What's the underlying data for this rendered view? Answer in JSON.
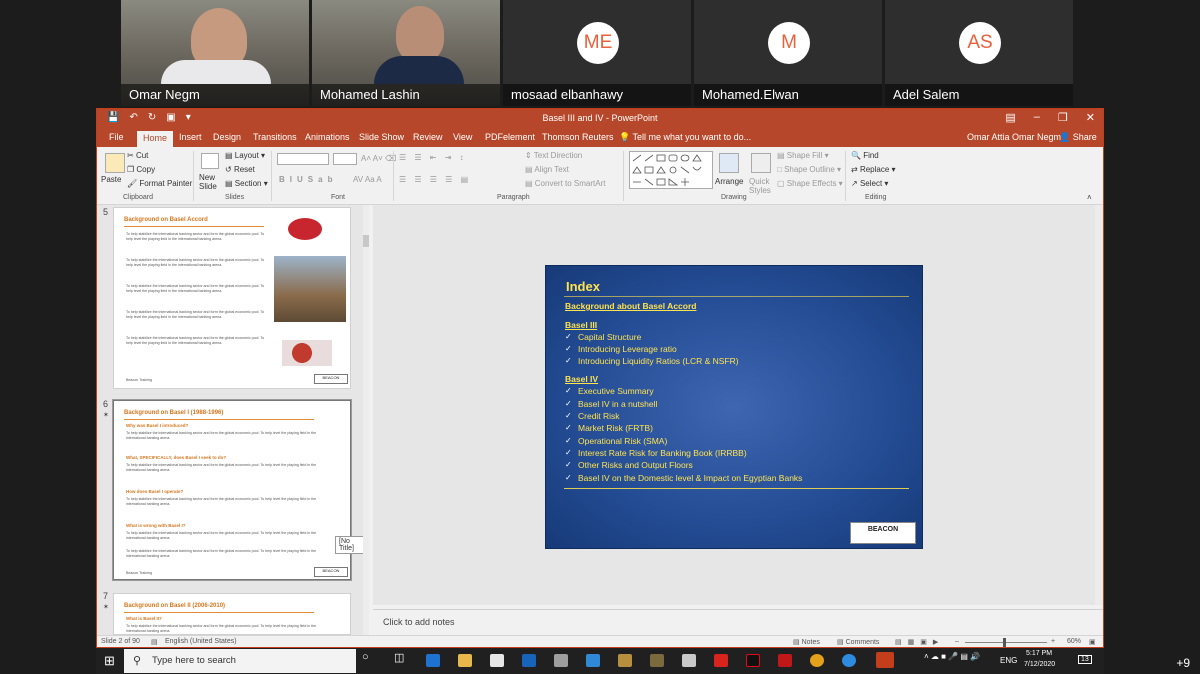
{
  "participants": [
    {
      "name": "Omar Negm",
      "type": "video"
    },
    {
      "name": "Mohamed Lashin",
      "type": "video"
    },
    {
      "name": "mosaad elbanhawy",
      "type": "avatar",
      "initials": "ME"
    },
    {
      "name": "Mohamed.Elwan",
      "type": "avatar",
      "initials": "M"
    },
    {
      "name": "Adel Salem",
      "type": "avatar",
      "initials": "AS"
    }
  ],
  "window": {
    "title": "Basel III and IV - PowerPoint",
    "user": "Omar Attia Omar Negm",
    "share": "Share"
  },
  "tabs": [
    "File",
    "Home",
    "Insert",
    "Design",
    "Transitions",
    "Animations",
    "Slide Show",
    "Review",
    "View",
    "PDFelement",
    "Thomson Reuters"
  ],
  "tell_me": "Tell me what you want to do...",
  "ribbon": {
    "paste": "Paste",
    "cut": "Cut",
    "copy": "Copy",
    "format_painter": "Format Painter",
    "clipboard": "Clipboard",
    "new_slide": "New Slide",
    "layout": "Layout",
    "reset": "Reset",
    "section": "Section",
    "slides": "Slides",
    "font": "Font",
    "paragraph": "Paragraph",
    "text_direction": "Text Direction",
    "align_text": "Align Text",
    "convert_smartart": "Convert to SmartArt",
    "arrange": "Arrange",
    "quick_styles": "Quick Styles",
    "shape_fill": "Shape Fill",
    "shape_outline": "Shape Outline",
    "shape_effects": "Shape Effects",
    "drawing": "Drawing",
    "find": "Find",
    "replace": "Replace",
    "select": "Select",
    "editing": "Editing"
  },
  "thumbnails": [
    {
      "num": "5",
      "title": "Background on Basel Accord",
      "footer": "Beacon Training"
    },
    {
      "num": "6",
      "title": "Background on Basel I (1988-1996)",
      "footer": "Beacon Training",
      "subs": [
        "Why was Basel I introduced?",
        "What, SPECIFICALLY, does Basel I seek to do?",
        "How does Basel I operate?",
        "What is wrong with Basel I?"
      ]
    },
    {
      "num": "7",
      "title": "Background on Basel II (2006-2010)",
      "sub": "What is Basel II?"
    }
  ],
  "thumb_body": "To help stabilize the international banking sector and form the global economic pool. To help level the playing field in the international banking arena.",
  "tooltip": "[No Title]",
  "slide": {
    "title": "Index",
    "sections": [
      {
        "heading": "Background about Basel Accord",
        "items": []
      },
      {
        "heading": "Basel III",
        "items": [
          "Capital Structure",
          "Introducing Leverage ratio",
          "Introducing Liquidity Ratios (LCR & NSFR)"
        ]
      },
      {
        "heading": "Basel IV",
        "items": [
          "Executive Summary",
          "Basel IV in a nutshell",
          "Credit Risk",
          "Market Risk (FRTB)",
          "Operational Risk (SMA)",
          "Interest Rate Risk for Banking Book (IRRBB)",
          "Other Risks and Output Floors",
          "Basel IV on the Domestic level & Impact on Egyptian Banks"
        ]
      }
    ],
    "logo": "BEACON"
  },
  "notes_placeholder": "Click to add notes",
  "status": {
    "slide": "Slide 2 of 90",
    "language": "English (United States)",
    "notes": "Notes",
    "comments": "Comments",
    "zoom": "60%"
  },
  "taskbar": {
    "search": "Type here to search",
    "lang": "ENG",
    "time": "5:17 PM",
    "date": "7/12/2020",
    "badge": "13"
  },
  "more_participants": "+9",
  "colors": {
    "ppt_accent": "#b7472a",
    "slide_bg": "#254e97",
    "slide_text": "#ffe34d",
    "avatar_text": "#e8613a"
  }
}
